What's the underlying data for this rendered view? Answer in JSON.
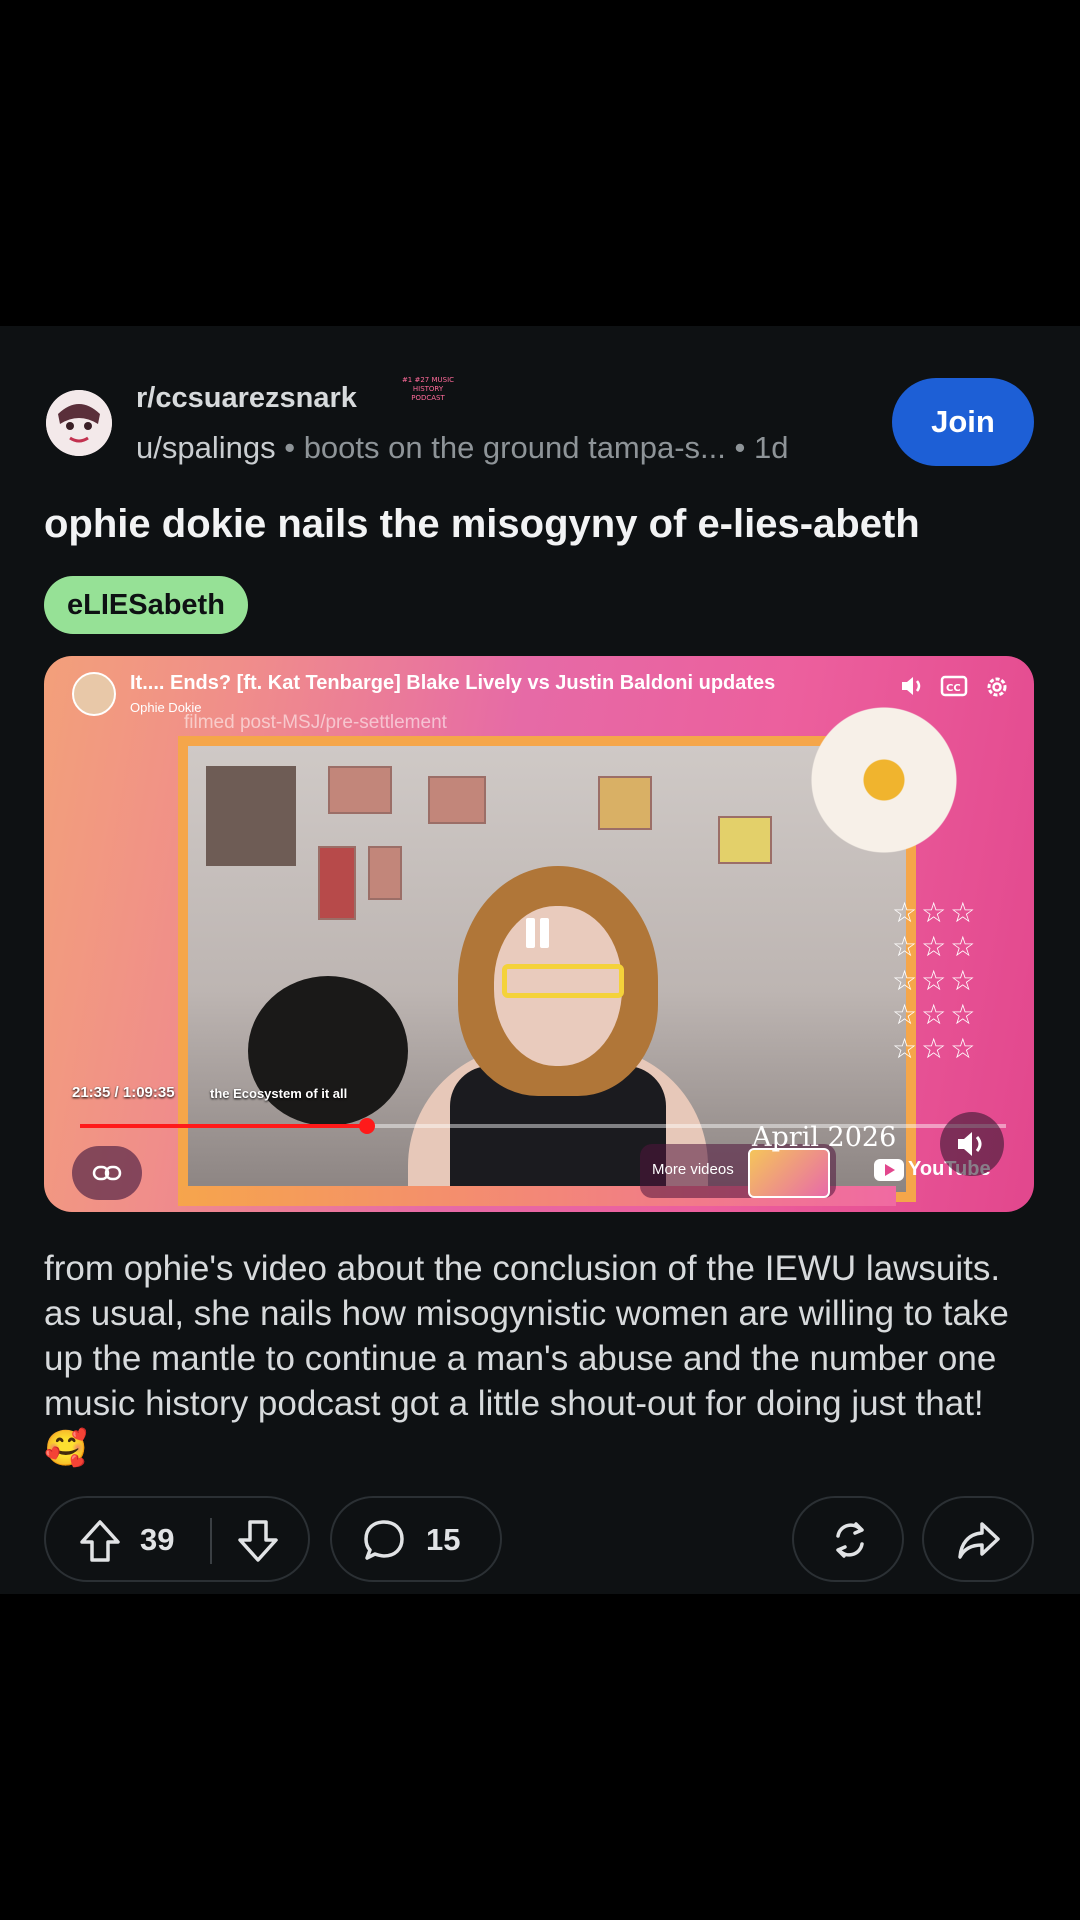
{
  "post": {
    "subreddit": "r/ccsuarezsnark",
    "mini_flair": "#1 #27 MUSIC HISTORY PODCAST",
    "author": "u/spalings",
    "author_flair": "boots on the ground tampa-s...",
    "age": "1d",
    "join_label": "Join",
    "title": "ophie dokie nails the misogyny of e-lies-abeth",
    "flair_tag": "eLIESabeth",
    "body": "from ophie's video about the conclusion of the IEWU lawsuits. as usual, she nails how misogynistic women are willing to take up the mantle to continue a man's abuse and the number one music history podcast got a little shout-out for doing just that! 🥰"
  },
  "video": {
    "title": "It.... Ends? [ft. Kat Tenbarge] Blake Lively vs Justin Baldoni updates",
    "channel": "Ophie Dokie",
    "overlay_text": "filmed post-MSJ/pre-settlement",
    "timecode": "21:35 / 1:09:35",
    "chapter": "the Ecosystem of it all",
    "progress_fraction": 0.3103,
    "more_videos_label": "More videos",
    "date_overlay": "April 2026",
    "youtube_label": "YouTube"
  },
  "actions": {
    "upvotes": "39",
    "comments": "15"
  },
  "colors": {
    "background": "#000000",
    "post_bg": "#0e1113",
    "join_button": "#1d5fd6",
    "flair_green": "#96e196",
    "progress_red": "#ff1a1a"
  },
  "icons": [
    "upvote-icon",
    "downvote-icon",
    "comment-icon",
    "award-icon",
    "share-icon",
    "link-icon",
    "volume-icon",
    "captions-icon",
    "settings-icon"
  ]
}
